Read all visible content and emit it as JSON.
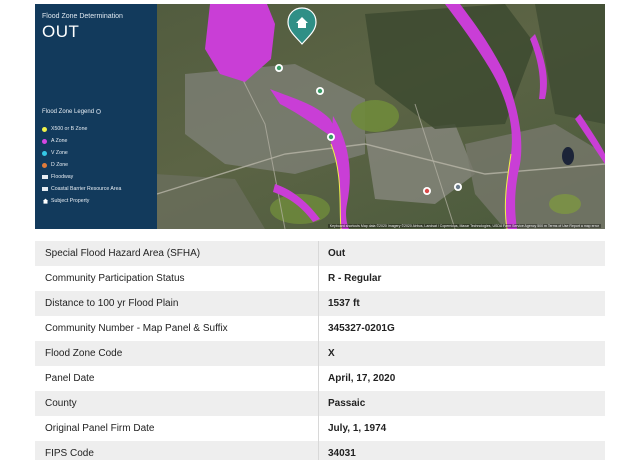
{
  "panel": {
    "heading": "Flood Zone Determination",
    "result": "OUT",
    "legend_title": "Flood Zone Legend",
    "legend": [
      {
        "label": "X500 or B Zone",
        "color": "#f1f24a",
        "icon": "dot"
      },
      {
        "label": "A Zone",
        "color": "#d447e3",
        "icon": "dot"
      },
      {
        "label": "V Zone",
        "color": "#35c8e6",
        "icon": "dot"
      },
      {
        "label": "D Zone",
        "color": "#e07b3a",
        "icon": "dot"
      },
      {
        "label": "Floodway",
        "color": "#e6ecf2",
        "icon": "floodway-icon"
      },
      {
        "label": "Coastal Barrier Resource Area",
        "color": "#e6ecf2",
        "icon": "coastal-barrier-icon"
      },
      {
        "label": "Subject Property",
        "color": "#ffffff",
        "icon": "home-icon"
      }
    ]
  },
  "map": {
    "flood_color": "#c93ed6",
    "marker_color": "#2f8f86",
    "attribution": "Keyboard shortcuts   Map data ©2020 Imagery ©2020 Airbus, Landsat / Copernicus, Maxar Technologies, USDA Farm Service Agency   500 m   Terms of Use   Report a map error"
  },
  "table": {
    "rows": [
      {
        "label": "Special Flood Hazard Area (SFHA)",
        "value": "Out"
      },
      {
        "label": "Community Participation Status",
        "value": "R - Regular"
      },
      {
        "label": "Distance to 100 yr Flood Plain",
        "value": "1537 ft"
      },
      {
        "label": "Community Number - Map Panel & Suffix",
        "value": "345327-0201G"
      },
      {
        "label": "Flood Zone Code",
        "value": "X"
      },
      {
        "label": "Panel Date",
        "value": "April, 17, 2020"
      },
      {
        "label": "County",
        "value": "Passaic"
      },
      {
        "label": "Original Panel Firm Date",
        "value": "July, 1, 1974"
      },
      {
        "label": "FIPS Code",
        "value": "34031"
      }
    ]
  }
}
